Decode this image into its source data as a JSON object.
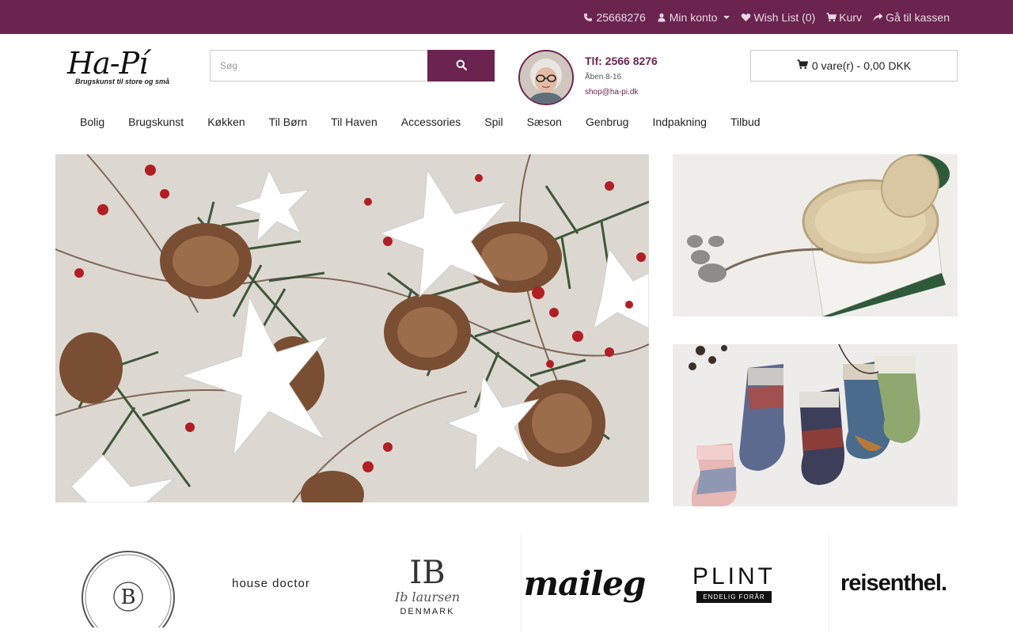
{
  "topbar": {
    "phone": "25668276",
    "account": "Min konto",
    "wishlist": "Wish List (0)",
    "cart": "Kurv",
    "checkout": "Gå til kassen"
  },
  "logo": {
    "word": "Ha-Pí",
    "tagline": "Brugskunst til store og små"
  },
  "search": {
    "placeholder": "Søg"
  },
  "contact": {
    "phone": "Tlf: 2566 8276",
    "hours": "Åben 8-16",
    "email": "shop@ha-pi.dk"
  },
  "cart_summary": {
    "label": "0 vare(r) - 0,00 DKK"
  },
  "nav": {
    "items": [
      "Bolig",
      "Brugskunst",
      "Køkken",
      "Til Børn",
      "Til Haven",
      "Accessories",
      "Spil",
      "Sæson",
      "Genbrug",
      "Indpakning",
      "Tilbud"
    ]
  },
  "brands": {
    "bloomingville": "bloomingville",
    "house_doctor": "house doctor",
    "ib_laursen": "Ib laursen",
    "ib_laursen_country": "DENMARK",
    "maileg": "maileg",
    "plint": "PLINT",
    "plint_tag": "ENDELIG FORÅR",
    "reisenthel": "reisenthel."
  },
  "colors": {
    "brand": "#6b2450",
    "topbar_text": "#e8d8e2"
  }
}
